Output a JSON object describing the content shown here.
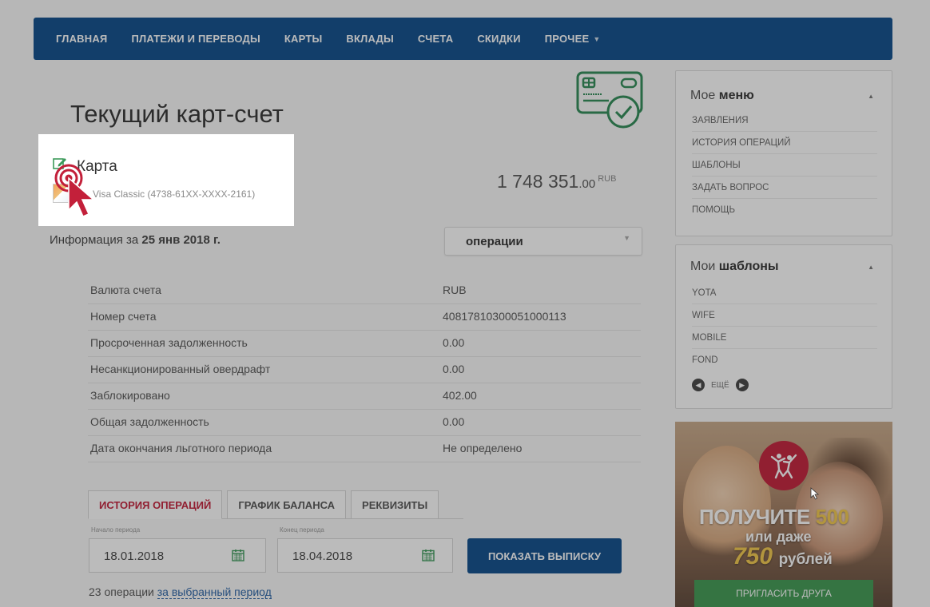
{
  "nav": {
    "items": [
      "ГЛАВНАЯ",
      "ПЛАТЕЖИ И ПЕРЕВОДЫ",
      "КАРТЫ",
      "ВКЛАДЫ",
      "СЧЕТА",
      "СКИДКИ",
      "ПРОЧЕЕ"
    ]
  },
  "page": {
    "title": "Текущий карт-счет"
  },
  "card": {
    "label": "Карта",
    "number": "Visa Classic (4738-61XX-XXXX-2161)"
  },
  "balance": {
    "integer": "1 748 351",
    "decimal": ".00",
    "currency": "RUB"
  },
  "info": {
    "prefix": "Информация за",
    "date": "25 янв 2018 г."
  },
  "ops_select": {
    "value": "операции"
  },
  "details": [
    {
      "key": "Валюта счета",
      "value": "RUB"
    },
    {
      "key": "Номер счета",
      "value": "40817810300051000113"
    },
    {
      "key": "Просроченная задолженность",
      "value": "0.00"
    },
    {
      "key": "Несанкционированный овердрафт",
      "value": "0.00"
    },
    {
      "key": "Заблокировано",
      "value": "402.00"
    },
    {
      "key": "Общая задолженность",
      "value": "0.00"
    },
    {
      "key": "Дата окончания льготного периода",
      "value": "Не определено"
    }
  ],
  "tabs": [
    "ИСТОРИЯ ОПЕРАЦИЙ",
    "ГРАФИК БАЛАНСА",
    "РЕКВИЗИТЫ"
  ],
  "period": {
    "start_label": "Начало периода",
    "start_value": "18.01.2018",
    "end_label": "Конец периода",
    "end_value": "18.04.2018",
    "button": "ПОКАЗАТЬ ВЫПИСКУ"
  },
  "ops_count": {
    "prefix": "23 операции",
    "link": "за выбранный период"
  },
  "my_menu": {
    "title_light": "Мое",
    "title_bold": "меню",
    "items": [
      "ЗАЯВЛЕНИЯ",
      "ИСТОРИЯ ОПЕРАЦИЙ",
      "ШАБЛОНЫ",
      "ЗАДАТЬ ВОПРОС",
      "ПОМОЩЬ"
    ]
  },
  "my_templates": {
    "title_light": "Мои",
    "title_bold": "шаблоны",
    "items": [
      "YOTA",
      "WIFE",
      "MOBILE",
      "FOND"
    ],
    "more": "ЕЩЁ"
  },
  "promo": {
    "line1": "ПОЛУЧИТЕ",
    "line1_num": "500",
    "line2": "или даже",
    "line3_num": "750",
    "line3_unit": "рублей",
    "button": "ПРИГЛАСИТЬ ДРУГА"
  },
  "colors": {
    "nav_bg": "#0d4d8c",
    "active_tab": "#c3203a",
    "promo_badge": "#c3203a",
    "promo_button": "#3f9a52",
    "icon_green": "#2e8b57"
  }
}
